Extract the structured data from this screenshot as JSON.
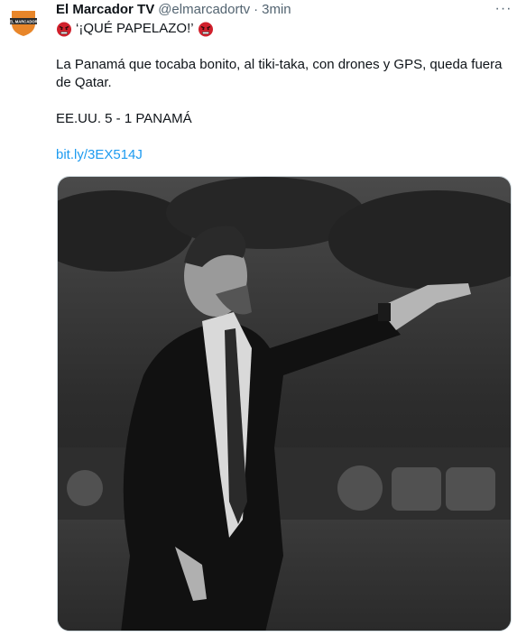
{
  "tweet": {
    "display_name": "El Marcador TV",
    "handle": "@elmarcadortv",
    "separator": "·",
    "time": "3min",
    "title": "‘¡QUÉ PAPELAZO!’",
    "paragraph": "La Panamá que tocaba bonito, al tiki-taka, con drones y GPS, queda fuera de Qatar.",
    "score": "EE.UU. 5 - 1 PANAMÁ",
    "link": "bit.ly/3EX514J",
    "more_glyph": "···"
  },
  "avatar": {
    "logo_text": "EL MARCADOR",
    "colors": {
      "shield": "#e8862a",
      "band": "#2b2b2b"
    }
  },
  "emoji": {
    "name": "angry-face-emoji",
    "color": "#d0202c"
  },
  "media": {
    "type": "black-and-white photo of a coach in suit pointing"
  },
  "colors": {
    "link": "#1d9bf0",
    "secondary": "#536471",
    "text": "#0f1419"
  }
}
